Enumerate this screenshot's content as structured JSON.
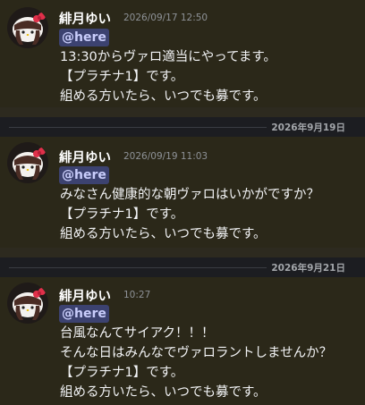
{
  "messages": [
    {
      "author": "緋月ゆい",
      "timestamp": "2026/09/17 12:50",
      "mention": "@here",
      "lines": [
        "13:30からヴァロ適当にやってます。",
        "【プラチナ1】です。",
        "組める方いたら、いつでも募です。"
      ]
    },
    {
      "author": "緋月ゆい",
      "timestamp": "2026/09/19 11:03",
      "mention": "@here",
      "lines": [
        "みなさん健康的な朝ヴァロはいかがですか？",
        "【プラチナ1】です。",
        "組める方いたら、いつでも募です。"
      ]
    },
    {
      "author": "緋月ゆい",
      "timestamp": "10:27",
      "mention": "@here",
      "lines": [
        "台風なんてサイアク！！！",
        "そんな日はみんなでヴァロラントしませんか？",
        "【プラチナ1】です。",
        "組める方いたら、いつでも募です。"
      ]
    }
  ],
  "dividers": [
    {
      "date": "2026年9月19日"
    },
    {
      "date": "2026年9月21日"
    }
  ],
  "colors": {
    "background": "#2b2819",
    "divider_band": "#1c1d21",
    "mention_bg": "#3c4270",
    "mention_text": "#c9cdfb",
    "timestamp": "#8e9297"
  },
  "icons": {
    "avatar": "hello-kitty-avatar-icon"
  }
}
